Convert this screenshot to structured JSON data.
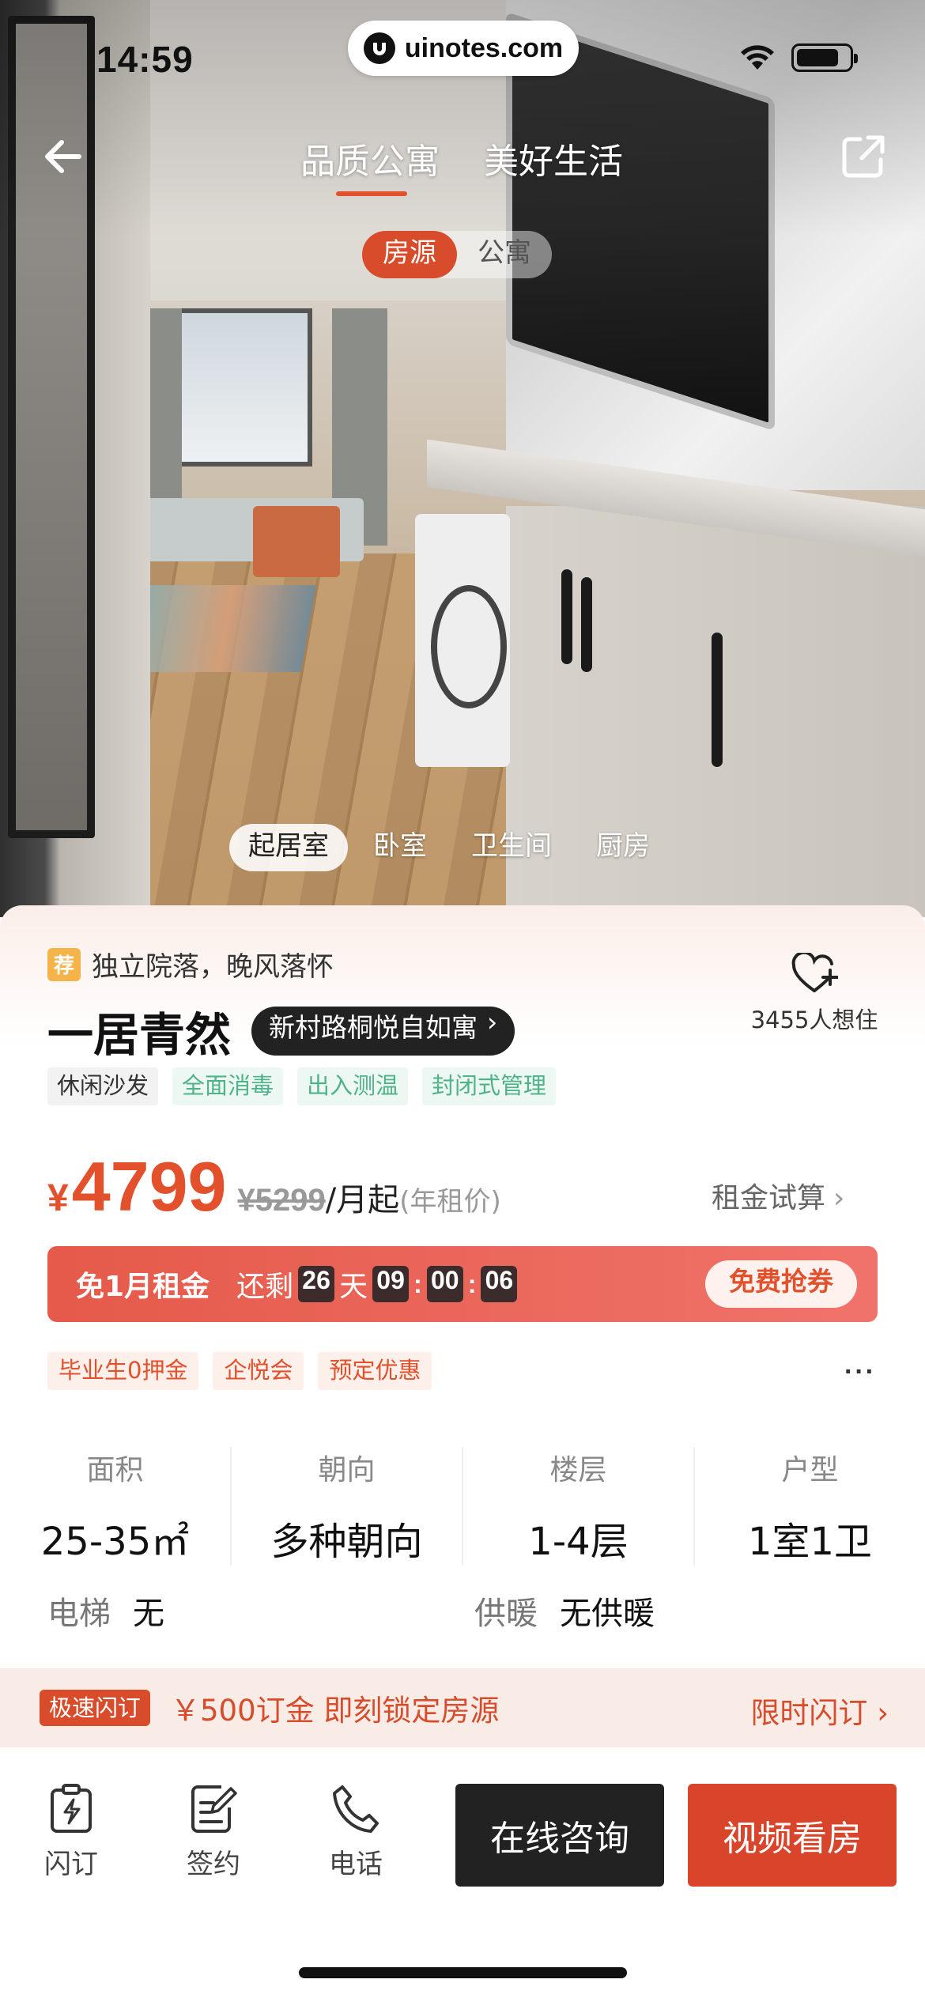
{
  "status_bar": {
    "time": "14:59",
    "watermark": "uinotes.com"
  },
  "nav": {
    "tabs": [
      {
        "label": "品质公寓"
      },
      {
        "label": "美好生活"
      }
    ],
    "segments": [
      {
        "label": "房源"
      },
      {
        "label": "公寓"
      }
    ]
  },
  "gallery": {
    "rooms": [
      {
        "label": "起居室"
      },
      {
        "label": "卧室"
      },
      {
        "label": "卫生间"
      },
      {
        "label": "厨房"
      }
    ]
  },
  "listing": {
    "recommend_badge": "荐",
    "recommend_text": "独立院落，晚风落怀",
    "title": "一居青然",
    "project": "新村路桐悦自如寓",
    "favorites": "3455人想住",
    "tags": [
      {
        "label": "休闲沙发",
        "style": "gray"
      },
      {
        "label": "全面消毒",
        "style": "green"
      },
      {
        "label": "出入测温",
        "style": "green"
      },
      {
        "label": "封闭式管理",
        "style": "green"
      }
    ]
  },
  "price": {
    "currency": "¥",
    "value": "4799",
    "original": "¥5299",
    "unit": "/月起",
    "note": "(年租价)",
    "calc_link": "租金试算"
  },
  "promo": {
    "title": "免1月租金",
    "remain_label": "还剩",
    "days": "26",
    "day_unit": "天",
    "hours": "09",
    "minutes": "00",
    "seconds": "06",
    "button": "免费抢券"
  },
  "offers": [
    {
      "label": "毕业生0押金"
    },
    {
      "label": "企悦会"
    },
    {
      "label": "预定优惠"
    }
  ],
  "specs": [
    {
      "label": "面积",
      "value": "25-35㎡"
    },
    {
      "label": "朝向",
      "value": "多种朝向"
    },
    {
      "label": "楼层",
      "value": "1-4层"
    },
    {
      "label": "户型",
      "value": "1室1卫"
    }
  ],
  "facts": [
    {
      "key": "电梯",
      "value": "无"
    },
    {
      "key": "供暖",
      "value": "无供暖"
    }
  ],
  "flash": {
    "badge": "极速闪订",
    "text": "￥500订金 即刻锁定房源",
    "link": "限时闪订"
  },
  "bottom_bar": {
    "actions": [
      {
        "label": "闪订"
      },
      {
        "label": "签约"
      },
      {
        "label": "电话"
      }
    ],
    "consult": "在线咨询",
    "video": "视频看房"
  },
  "colors": {
    "accent": "#e2502c",
    "green": "#4fb389",
    "dark": "#222222"
  }
}
